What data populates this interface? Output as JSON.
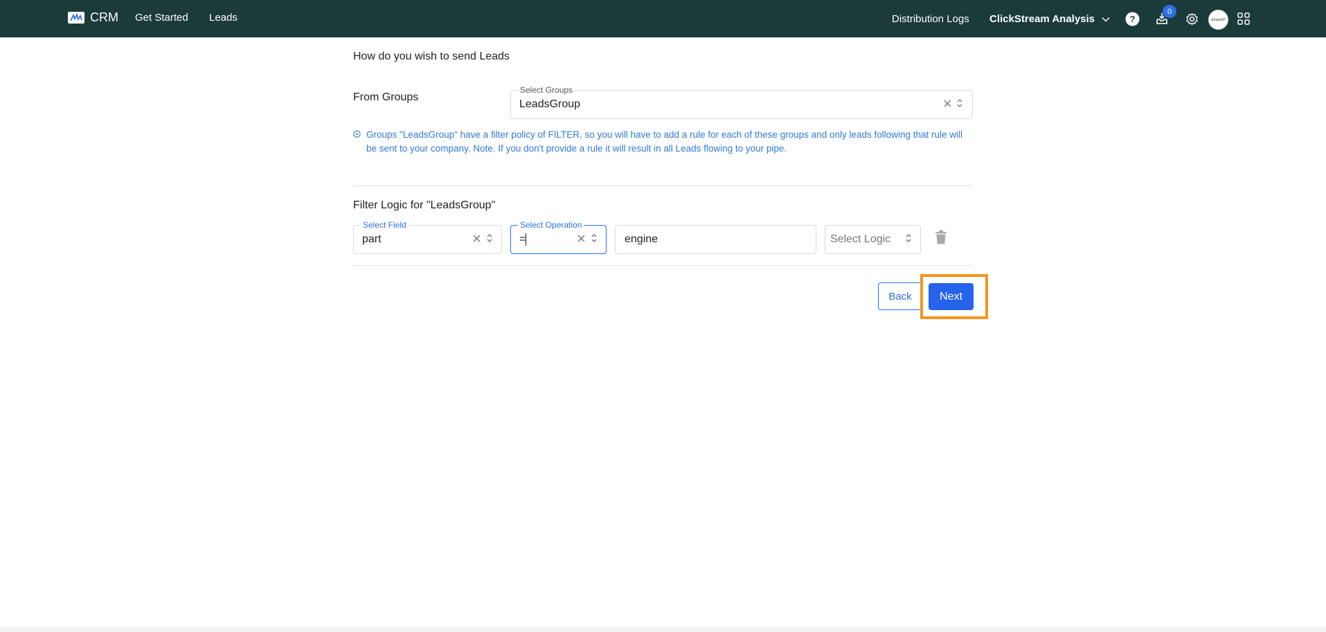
{
  "topbar": {
    "brand_name": "CRM",
    "nav": {
      "get_started": "Get Started",
      "leads": "Leads"
    },
    "right": {
      "distribution_logs": "Distribution Logs",
      "clickstream": "ClickStream Analysis",
      "inbox_count": "0",
      "avatar_text": "●StanGP"
    },
    "colors": {
      "background": "#1b3a3a",
      "badge": "#2f6fe4"
    }
  },
  "main": {
    "title": "How do you wish to send Leads",
    "from_groups_label": "From Groups",
    "groups_select": {
      "label": "Select Groups",
      "value": "LeadsGroup"
    },
    "info_text": "Groups \"LeadsGroup\" have a filter policy of FILTER, so you will have to add a rule for each of these groups and only leads following that rule will be sent to your company. Note. If you don't provide a rule it will result in all Leads flowing to your pipe.",
    "filter_title": "Filter Logic for \"LeadsGroup\"",
    "field_select": {
      "label": "Select Field",
      "value": "part"
    },
    "operation_select": {
      "label": "Select Operation",
      "value": "="
    },
    "value_input": {
      "value": "engine"
    },
    "logic_select": {
      "placeholder": "Select Logic"
    },
    "buttons": {
      "back": "Back",
      "next": "Next"
    },
    "colors": {
      "accent": "#2f6fe4",
      "primary_button": "#2563eb",
      "highlight": "#f7941d",
      "info_text": "#2f7ad8"
    }
  }
}
